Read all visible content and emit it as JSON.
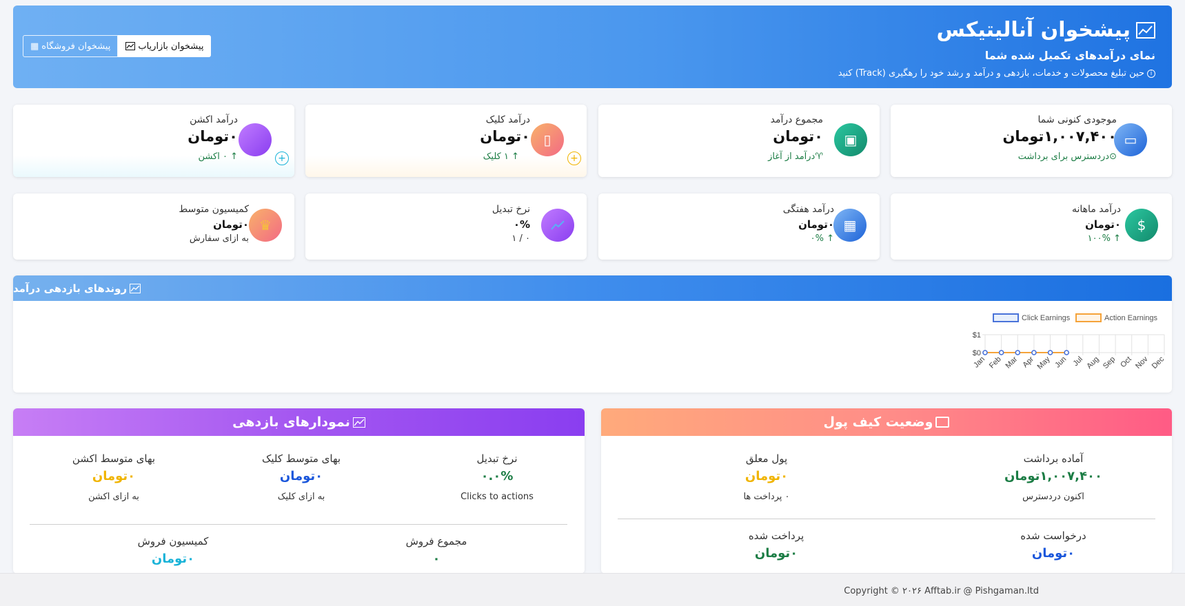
{
  "header": {
    "title": "پیشخوان آنالیتیکس",
    "subtitle": "نمای درآمدهای تکمیل شده شما",
    "description": "حین تبلیغ محصولات و خدمات، بازدهی و درآمد و رشد خود را رهگیری (Track) کنید",
    "btn_marketer": "پیشخوان بازاریاب",
    "btn_store": "پیشخوان فروشگاه"
  },
  "stats_top": {
    "balance": {
      "label": "موجودی کنونی شما",
      "value": "۱,۰۰۷,۴۰۰تومان",
      "sub": "دردسترس برای برداشت"
    },
    "total": {
      "label": "مجموع درآمد",
      "value": "۰تومان",
      "sub": "درآمد از آغاز"
    },
    "click": {
      "label": "درآمد کلیک",
      "value": "۰تومان",
      "sub": "↑ ۱ کلیک"
    },
    "action": {
      "label": "درآمد اکشن",
      "value": "۰تومان",
      "sub": "↑ ۰ اکشن"
    }
  },
  "stats_bottom": {
    "monthly": {
      "label": "درآمد ماهانه",
      "value": "۰تومان",
      "sub": "↑ ۱۰۰%"
    },
    "weekly": {
      "label": "درآمد هفتگی",
      "value": "۰تومان",
      "sub": "↑ ۰%"
    },
    "conversion": {
      "label": "نرخ تبدیل",
      "value": "۰%",
      "sub": "۰ / ۱"
    },
    "commission": {
      "label": "کمیسیون متوسط",
      "value": "۰تومان",
      "sub": "به ازای سفارش"
    }
  },
  "trend": {
    "title": "روندهای بازدهی درآمد"
  },
  "chart_data": {
    "type": "line",
    "categories": [
      "Jan",
      "Feb",
      "Mar",
      "Apr",
      "May",
      "Jun",
      "Jul",
      "Aug",
      "Sep",
      "Oct",
      "Nov",
      "Dec"
    ],
    "series": [
      {
        "name": "Click Earnings",
        "values": [
          0,
          0,
          0,
          0,
          0,
          0,
          null,
          null,
          null,
          null,
          null,
          null
        ],
        "color": "#4a73d9"
      },
      {
        "name": "Action Earnings",
        "values": [
          0,
          0,
          0,
          0,
          0,
          0,
          null,
          null,
          null,
          null,
          null,
          null
        ],
        "color": "#f5a33a"
      }
    ],
    "yticks": [
      "$1",
      "$0"
    ],
    "ylim": [
      0,
      1
    ],
    "legend": "top",
    "grid": true
  },
  "wallet": {
    "title": "وضعیت کیف پول",
    "ready_label": "آماده برداشت",
    "ready_value": "۱,۰۰۷,۴۰۰تومان",
    "ready_sub": "اکنون دردسترس",
    "pending_label": "پول معلق",
    "pending_value": "۰تومان",
    "pending_sub": "۰ پرداخت ها",
    "requested_label": "درخواست شده",
    "requested_value": "۰تومان",
    "paid_label": "پرداخت شده",
    "paid_value": "۰تومان"
  },
  "perf": {
    "title": "نمودارهای بازدهی",
    "conv_label": "نرخ تبدیل",
    "conv_value": "۰.۰%",
    "conv_sub": "Clicks to actions",
    "avg_click_label": "بهای متوسط کلیک",
    "avg_click_value": "۰تومان",
    "avg_click_sub": "به ازای کلیک",
    "avg_action_label": "بهای متوسط اکشن",
    "avg_action_value": "۰تومان",
    "avg_action_sub": "به ازای اکشن",
    "sales_total_label": "مجموع فروش",
    "sales_total_value": "۰",
    "sales_comm_label": "کمیسیون فروش",
    "sales_comm_value": "۰تومان"
  },
  "footer": {
    "copyright": "Copyright © ۲۰۲۶ Afftab.ir @ Pishgaman.ltd"
  },
  "colors": {
    "green": "#1c7d45",
    "blue": "#1a56db",
    "yellow": "#f0b400",
    "cyan": "#1ab3d8"
  }
}
